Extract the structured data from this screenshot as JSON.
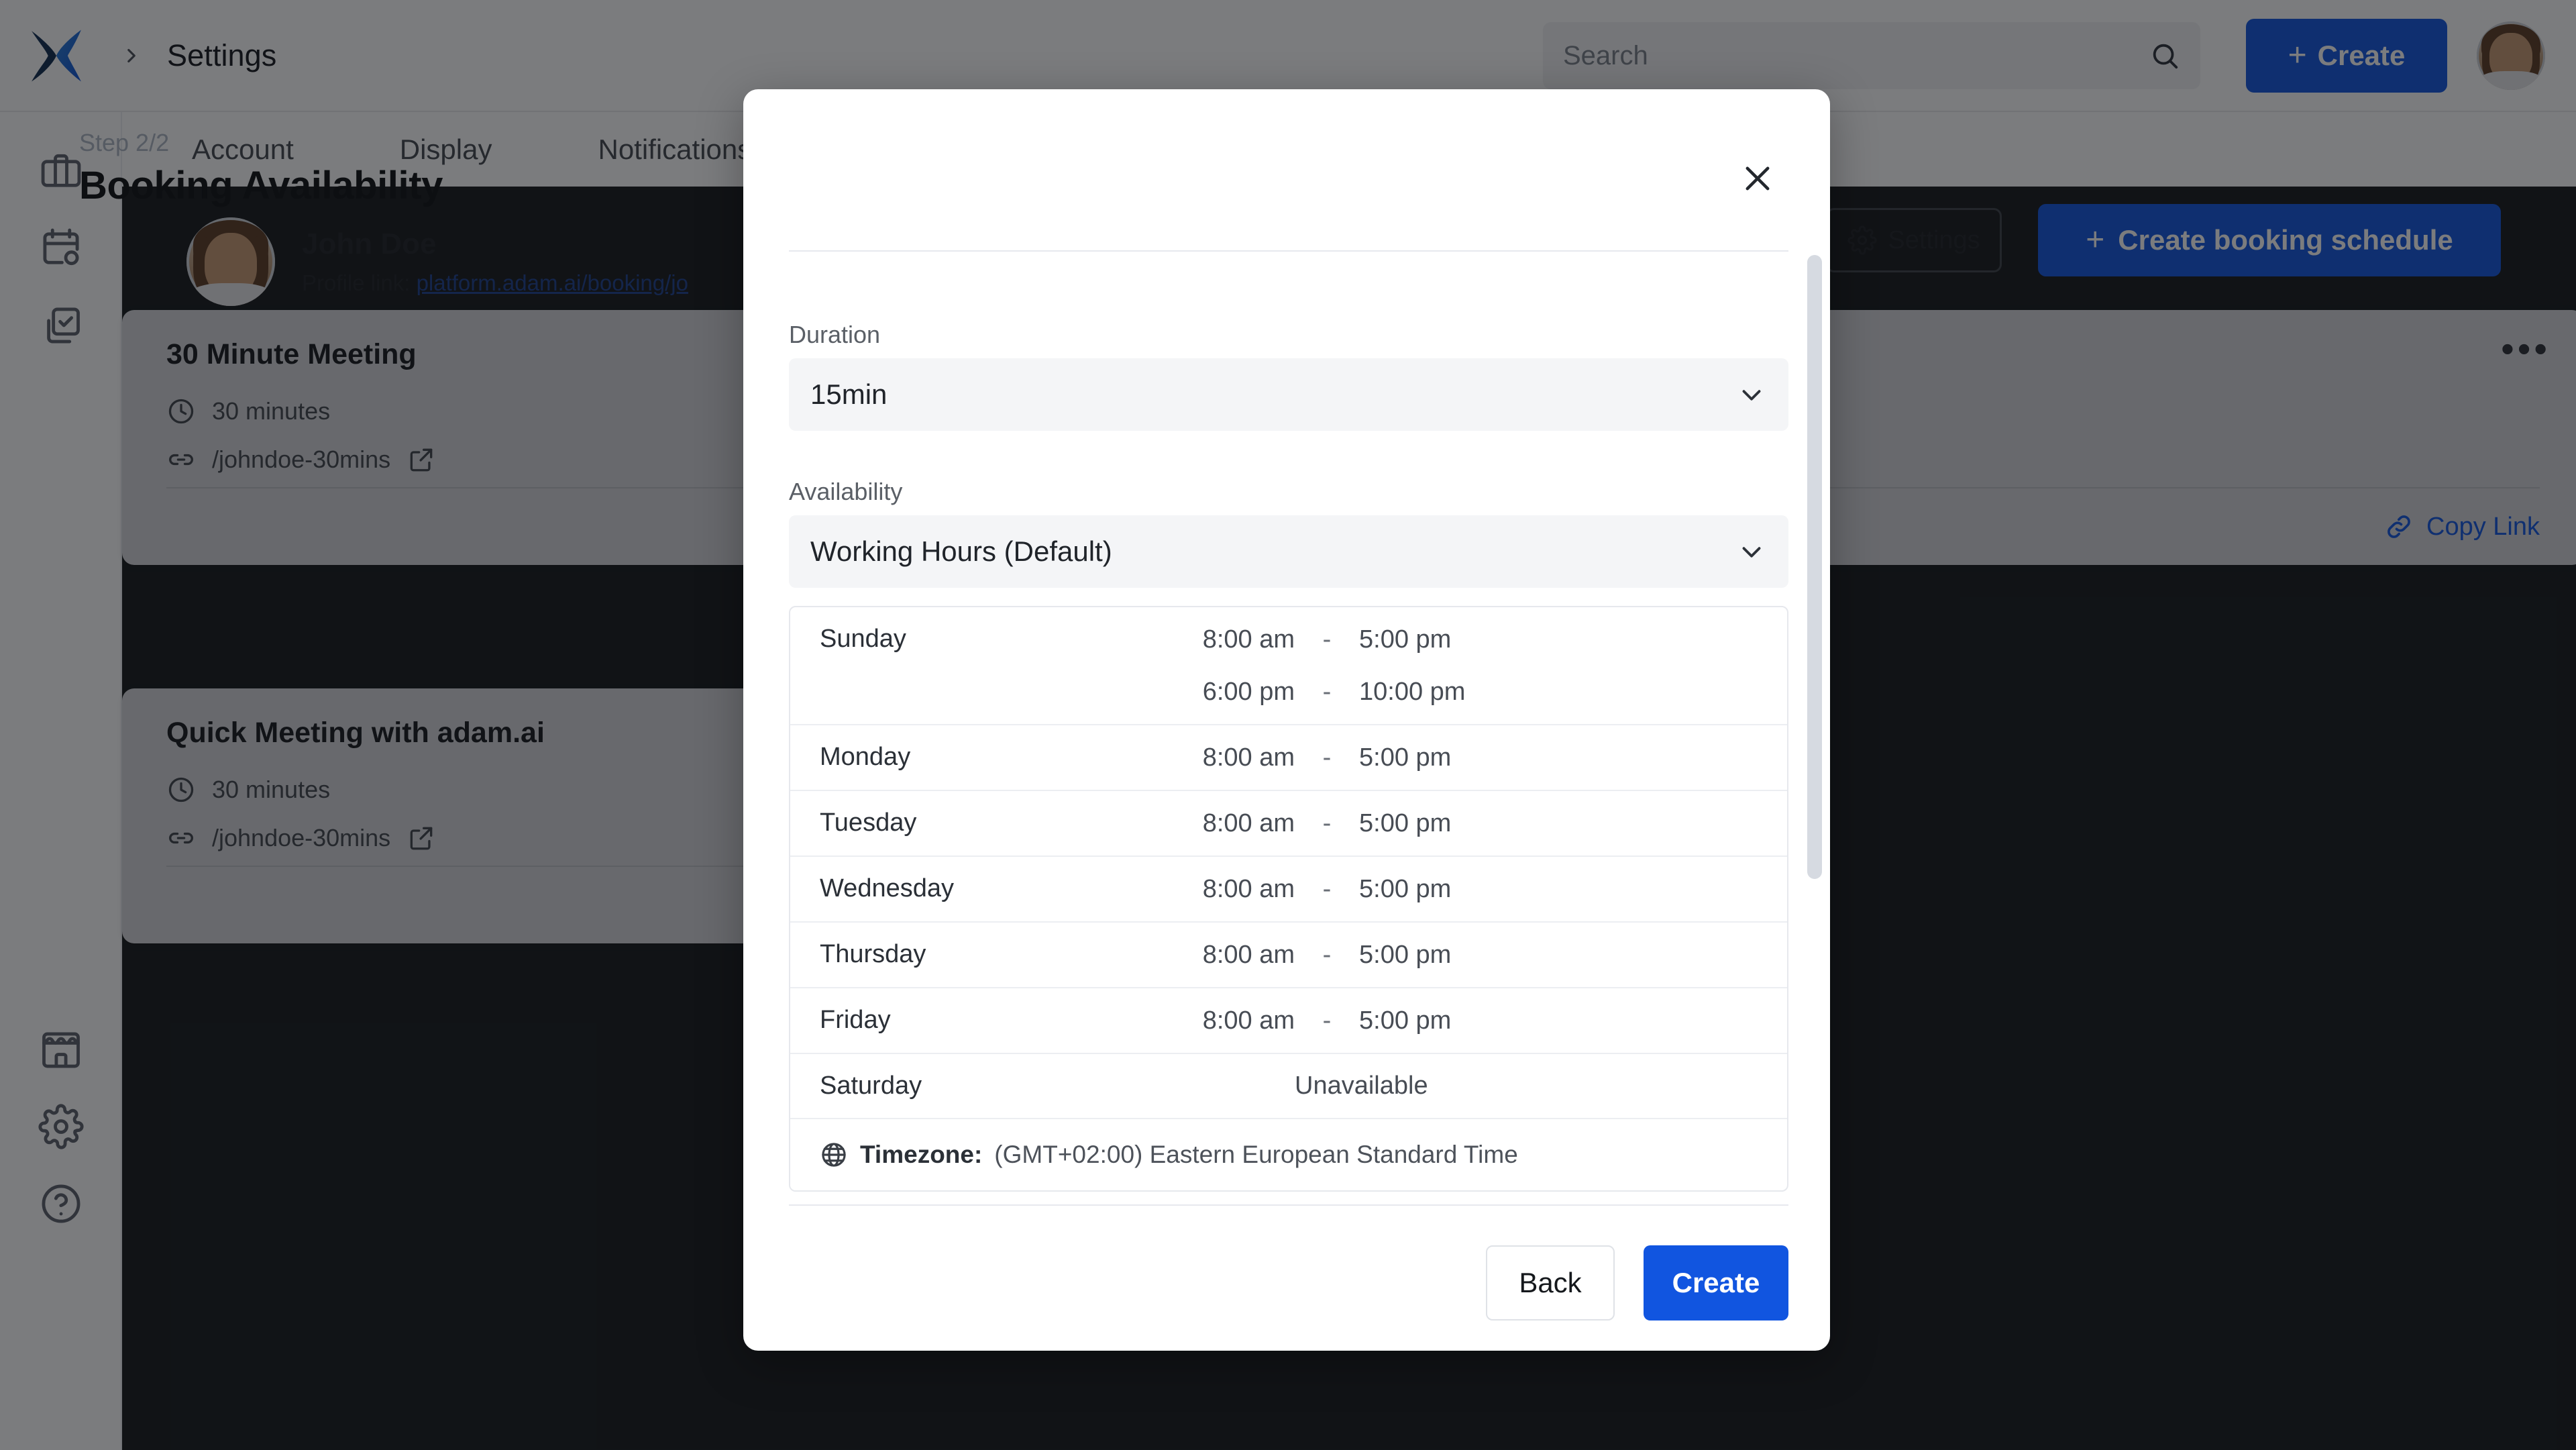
{
  "topbar": {
    "breadcrumb_title": "Settings",
    "search_placeholder": "Search",
    "search_value": "",
    "create_label": "Create",
    "create_plus": "+",
    "logo_name": "adam-ai-logo"
  },
  "rail": {
    "items": [
      {
        "name": "briefcase-icon",
        "label": "Workspace"
      },
      {
        "name": "calendar-clock-icon",
        "label": "Meetings"
      },
      {
        "name": "tasks-icon",
        "label": "Tasks"
      }
    ],
    "bottom_items": [
      {
        "name": "store-icon",
        "label": "Marketplace"
      },
      {
        "name": "gear-icon",
        "label": "Settings"
      },
      {
        "name": "help-circle-icon",
        "label": "Help"
      }
    ]
  },
  "tabs": [
    {
      "label": "Account"
    },
    {
      "label": "Display"
    },
    {
      "label": "Notifications"
    }
  ],
  "profile": {
    "name": "John Doe",
    "link_label": "Profile link:",
    "link_url": "platform.adam.ai/booking/jo"
  },
  "page_actions": {
    "settings_label": "Settings",
    "create_schedule_label": "Create booking schedule",
    "create_schedule_plus": "+"
  },
  "cards": [
    {
      "title": "30 Minute Meeting",
      "duration": "30 minutes",
      "slug": "/johndoe-30mins",
      "copy_link_label": "Copy Link"
    },
    {
      "title": "Quick Meeting with adam.ai",
      "duration": "30 minutes",
      "slug": "/johndoe-30mins",
      "copy_link_label": "Copy Link"
    },
    {
      "title": "Quick Meeting with adam.ai",
      "duration": "30 minutes",
      "slug": "/johndoe-30mins",
      "copy_link_label": "Copy Link",
      "menu_dots": "•••"
    }
  ],
  "modal": {
    "step": "Step 2/2",
    "title": "Booking Availability",
    "duration_label": "Duration",
    "duration_value": "15min",
    "availability_label": "Availability",
    "availability_value": "Working Hours (Default)",
    "back_label": "Back",
    "create_label": "Create",
    "timezone_label": "Timezone:",
    "timezone_value": "(GMT+02:00) Eastern European Standard Time",
    "unavailable_text": "Unavailable",
    "dash": "-",
    "schedule": [
      {
        "day": "Sunday",
        "slots": [
          {
            "start": "8:00 am",
            "end": "5:00 pm"
          },
          {
            "start": "6:00 pm",
            "end": "10:00 pm"
          }
        ]
      },
      {
        "day": "Monday",
        "slots": [
          {
            "start": "8:00 am",
            "end": "5:00 pm"
          }
        ]
      },
      {
        "day": "Tuesday",
        "slots": [
          {
            "start": "8:00 am",
            "end": "5:00 pm"
          }
        ]
      },
      {
        "day": "Wednesday",
        "slots": [
          {
            "start": "8:00 am",
            "end": "5:00 pm"
          }
        ]
      },
      {
        "day": "Thursday",
        "slots": [
          {
            "start": "8:00 am",
            "end": "5:00 pm"
          }
        ]
      },
      {
        "day": "Friday",
        "slots": [
          {
            "start": "8:00 am",
            "end": "5:00 pm"
          }
        ]
      },
      {
        "day": "Saturday",
        "slots": []
      }
    ]
  },
  "colors": {
    "accent_blue": "#1155e0",
    "dark_panel": "#14181a",
    "card_bg": "#d4d6d9",
    "field_bg": "#f4f5f7"
  }
}
